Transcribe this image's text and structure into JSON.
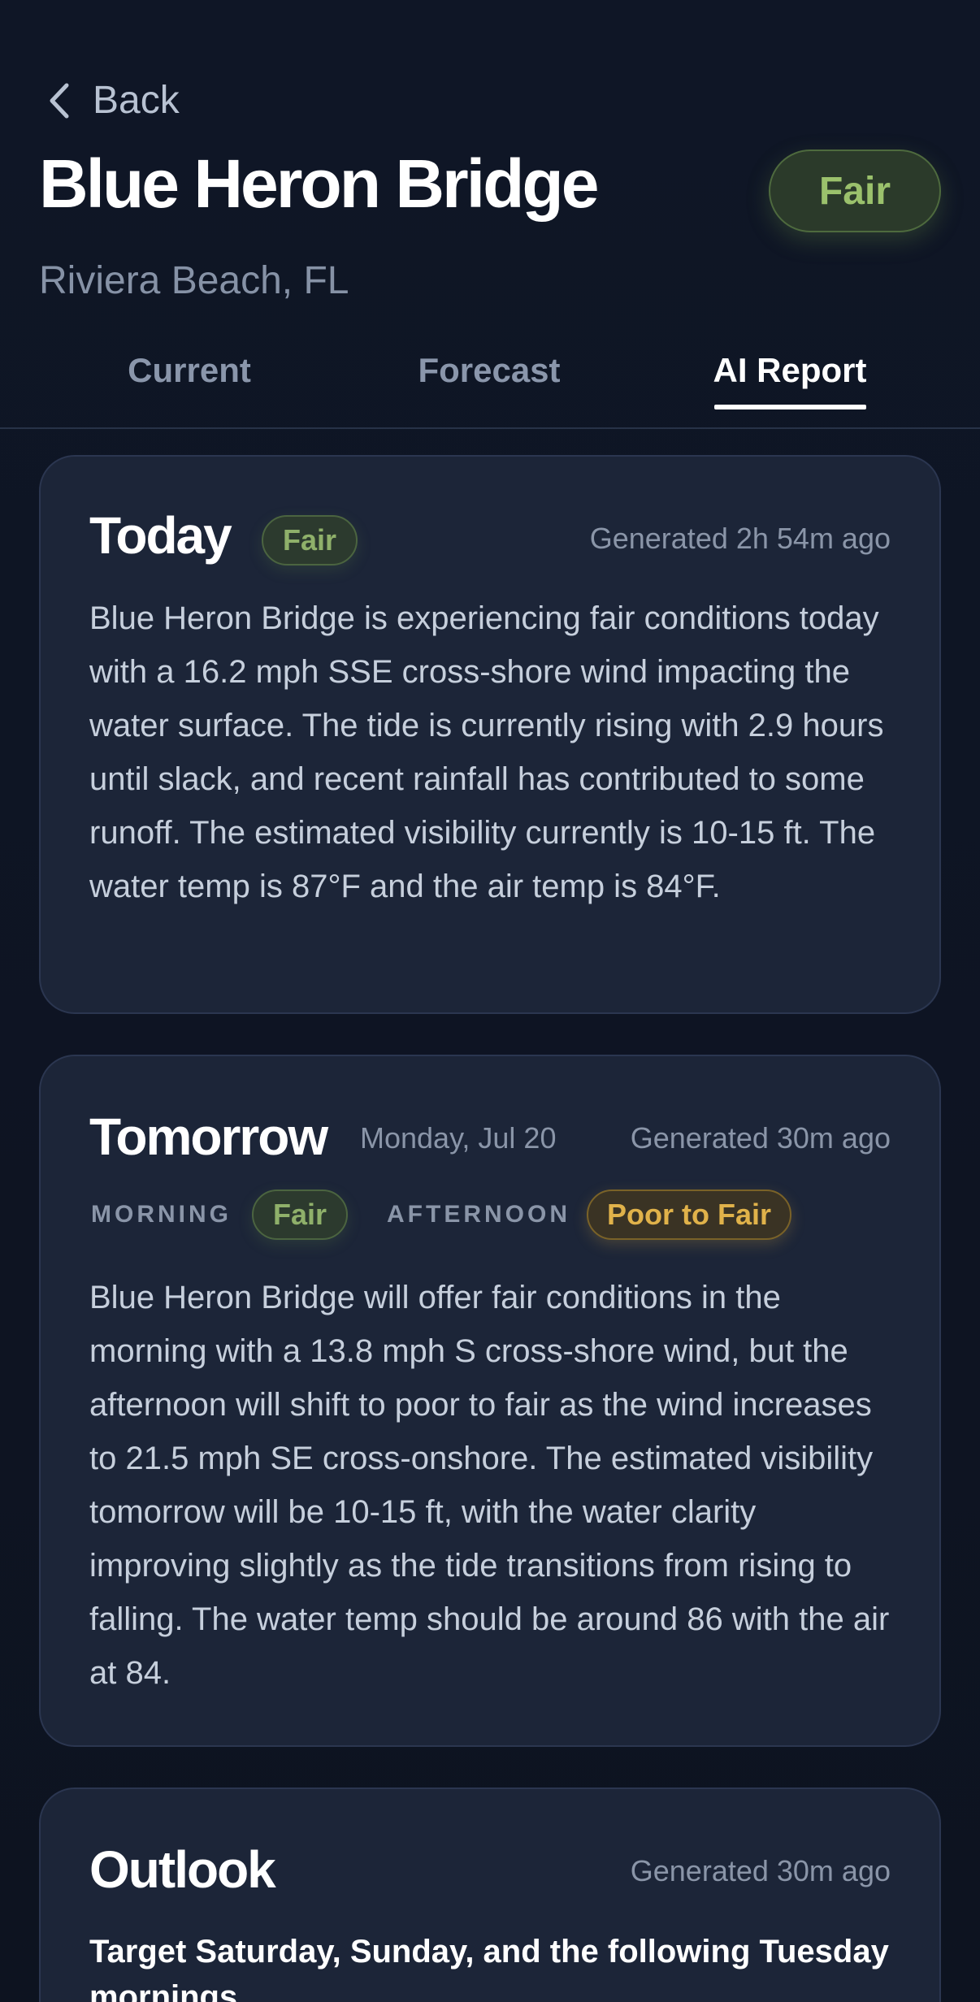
{
  "header": {
    "back_label": "Back",
    "title": "Blue Heron Bridge",
    "rating": "Fair",
    "location": "Riviera Beach, FL"
  },
  "tabs": [
    {
      "label": "Current",
      "active": false
    },
    {
      "label": "Forecast",
      "active": false
    },
    {
      "label": "AI Report",
      "active": true
    }
  ],
  "today": {
    "title": "Today",
    "rating": "Fair",
    "generated": "Generated 2h 54m ago",
    "text": "Blue Heron Bridge is experiencing fair conditions today with a 16.2 mph SSE cross-shore wind impacting the water surface. The tide is currently rising with 2.9 hours until slack, and recent rainfall has contributed to some runoff. The estimated visibility currently is 10-15 ft. The water temp is 87°F and the air temp is 84°F."
  },
  "tomorrow": {
    "title": "Tomorrow",
    "date": "Monday, Jul 20",
    "generated": "Generated 30m ago",
    "morning_label": "MORNING",
    "morning_rating": "Fair",
    "afternoon_label": "AFTERNOON",
    "afternoon_rating": "Poor to Fair",
    "text": "Blue Heron Bridge will offer fair conditions in the morning with a 13.8 mph S cross-shore wind, but the afternoon will shift to poor to fair as the wind increases to 21.5 mph SE cross-onshore. The estimated visibility tomorrow will be 10-15 ft, with the water clarity improving slightly as the tide transitions from rising to falling. The water temp should be around 86 with the air at 84."
  },
  "outlook": {
    "title": "Outlook",
    "generated": "Generated 30m ago",
    "headline": "Target Saturday, Sunday, and the following Tuesday mornings"
  },
  "colors": {
    "background": "#0e1422",
    "card": "#1c2538",
    "fair": "#8fb06a",
    "poor_to_fair": "#e0b24a"
  }
}
